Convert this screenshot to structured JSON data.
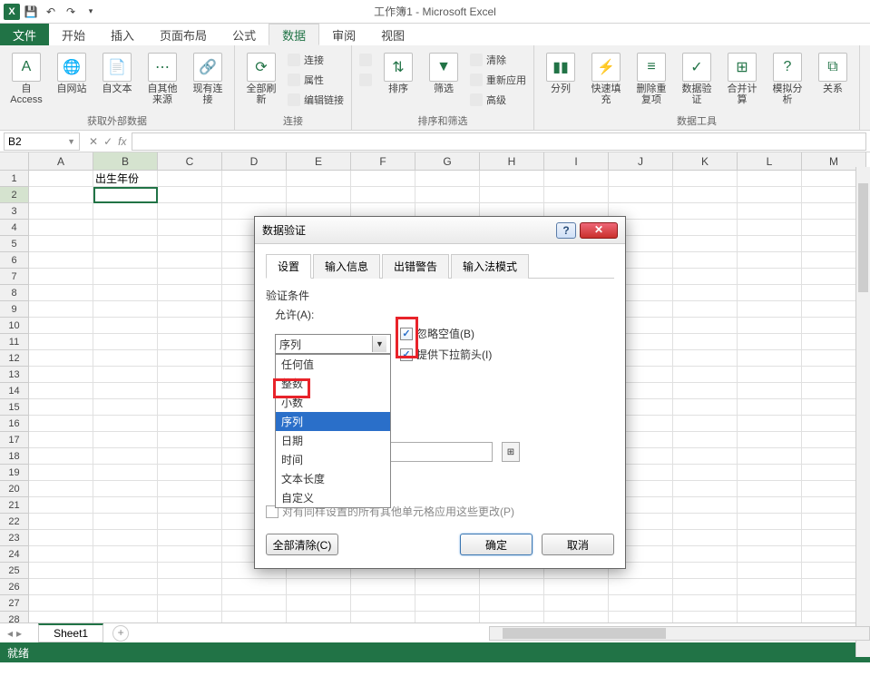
{
  "app": {
    "title": "工作簿1 - Microsoft Excel"
  },
  "tabs": {
    "file": "文件",
    "home": "开始",
    "insert": "插入",
    "pagelayout": "页面布局",
    "formulas": "公式",
    "data": "数据",
    "review": "审阅",
    "view": "视图"
  },
  "ribbon": {
    "ext": {
      "access": "自 Access",
      "web": "自网站",
      "text": "自文本",
      "other": "自其他来源",
      "existing": "现有连接",
      "label": "获取外部数据"
    },
    "conn": {
      "refresh": "全部刷新",
      "connections": "连接",
      "properties": "属性",
      "editlinks": "编辑链接",
      "label": "连接"
    },
    "sort": {
      "az": "A↓Z",
      "za": "Z↓A",
      "sort": "排序",
      "filter": "筛选",
      "clear": "清除",
      "reapply": "重新应用",
      "advanced": "高级",
      "label": "排序和筛选"
    },
    "tools": {
      "t2c": "分列",
      "flash": "快速填充",
      "dup": "删除重复项",
      "valid": "数据验证",
      "consol": "合并计算",
      "whatif": "模拟分析",
      "rel": "关系",
      "label": "数据工具"
    }
  },
  "namebox": "B2",
  "columns": [
    "A",
    "B",
    "C",
    "D",
    "E",
    "F",
    "G",
    "H",
    "I",
    "J",
    "K",
    "L",
    "M"
  ],
  "rows": [
    "1",
    "2",
    "3",
    "4",
    "5",
    "6",
    "7",
    "8",
    "9",
    "10",
    "11",
    "12",
    "13",
    "14",
    "15",
    "16",
    "17",
    "18",
    "19",
    "20",
    "21",
    "22",
    "23",
    "24",
    "25",
    "26",
    "27",
    "28"
  ],
  "cellB1": "出生年份",
  "dialog": {
    "title": "数据验证",
    "tabs": {
      "settings": "设置",
      "input": "输入信息",
      "error": "出错警告",
      "ime": "输入法模式"
    },
    "criteria": "验证条件",
    "allow": "允许(A):",
    "selected": "序列",
    "options": [
      "任何值",
      "整数",
      "小数",
      "序列",
      "日期",
      "时间",
      "文本长度",
      "自定义"
    ],
    "ignoreBlank": "忽略空值(B)",
    "dropdown": "提供下拉箭头(I)",
    "applyAll": "对有同样设置的所有其他单元格应用这些更改(P)",
    "clearAll": "全部清除(C)",
    "ok": "确定",
    "cancel": "取消"
  },
  "sheet": {
    "name": "Sheet1"
  },
  "status": "就绪"
}
